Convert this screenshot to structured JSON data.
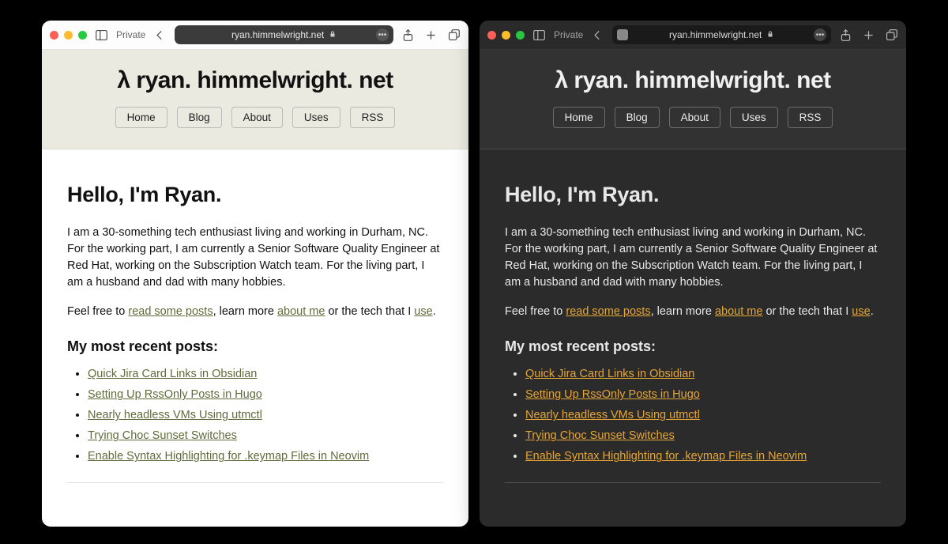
{
  "browser": {
    "private_label": "Private",
    "url_display": "ryan.himmelwright.net"
  },
  "site": {
    "title": "λ ryan. himmelwright. net",
    "nav": [
      "Home",
      "Blog",
      "About",
      "Uses",
      "RSS"
    ]
  },
  "intro": {
    "heading": "Hello, I'm Ryan.",
    "p1": "I am a 30-something tech enthusiast living and working in Durham, NC. For the working part, I am currently a Senior Software Quality Engineer at Red Hat, working on the Subscription Watch team. For the living part, I am a husband and dad with many hobbies.",
    "p2_pre": "Feel free to ",
    "p2_link1": "read some posts",
    "p2_mid1": ", learn more ",
    "p2_link2": "about me",
    "p2_mid2": " or the tech that I ",
    "p2_link3": "use",
    "p2_post": "."
  },
  "recent": {
    "heading": "My most recent posts:",
    "items": [
      "Quick Jira Card Links in Obsidian",
      "Setting Up RssOnly Posts in Hugo",
      "Nearly headless VMs Using utmctl",
      "Trying Choc Sunset Switches",
      "Enable Syntax Highlighting for .keymap Files in Neovim"
    ]
  }
}
